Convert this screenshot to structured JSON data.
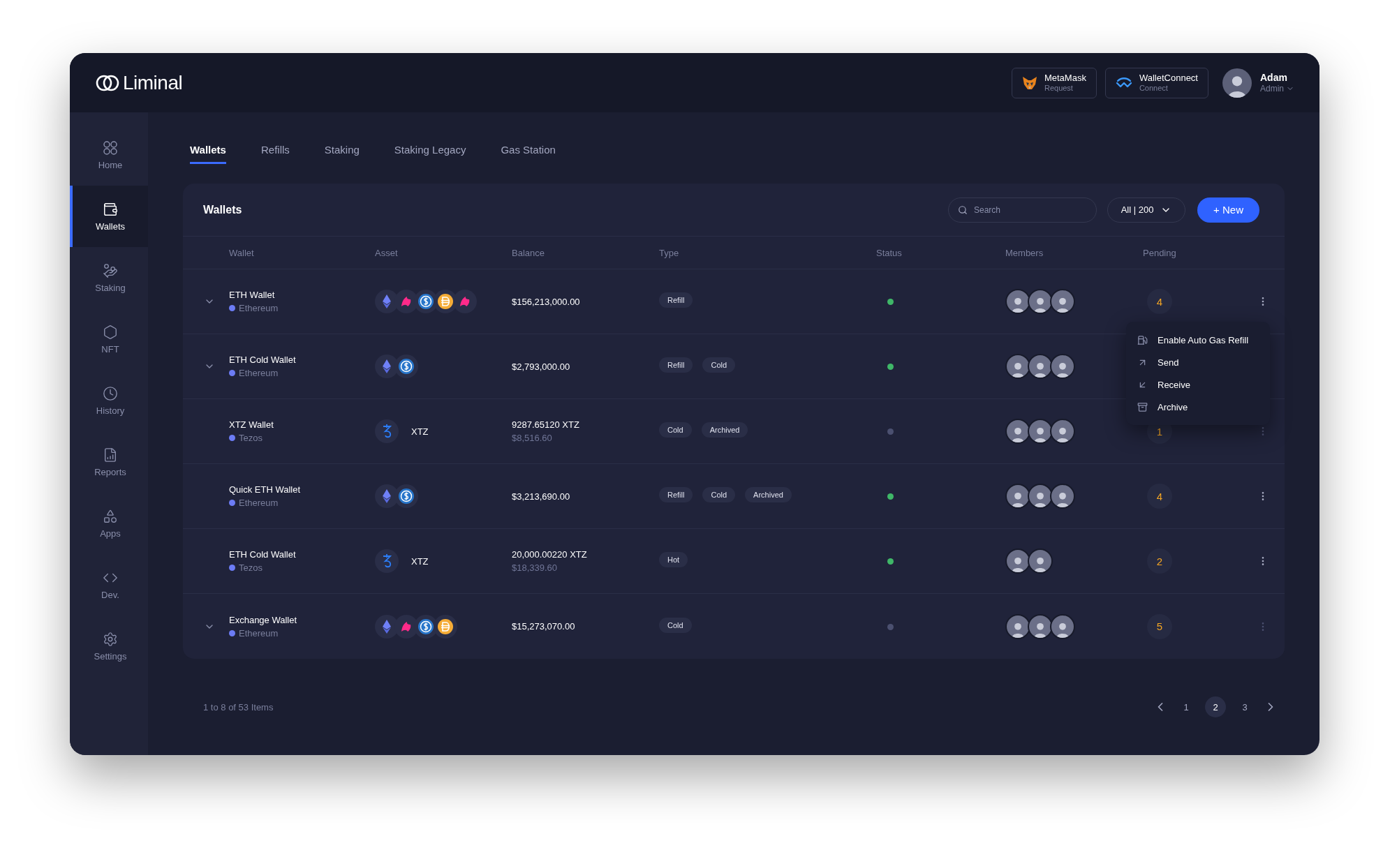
{
  "logo": "Liminal",
  "header": {
    "connections": [
      {
        "name": "MetaMask",
        "action": "Request",
        "kind": "metamask"
      },
      {
        "name": "WalletConnect",
        "action": "Connect",
        "kind": "walletconnect"
      }
    ],
    "user": {
      "name": "Adam",
      "role": "Admin"
    }
  },
  "sidebar": {
    "items": [
      {
        "label": "Home",
        "kind": "home",
        "selected": false
      },
      {
        "label": "Wallets",
        "kind": "wallet",
        "selected": true
      },
      {
        "label": "Staking",
        "kind": "staking",
        "selected": false
      },
      {
        "label": "NFT",
        "kind": "nft",
        "selected": false
      },
      {
        "label": "History",
        "kind": "history",
        "selected": false
      },
      {
        "label": "Reports",
        "kind": "reports",
        "selected": false
      },
      {
        "label": "Apps",
        "kind": "apps",
        "selected": false
      },
      {
        "label": "Dev.",
        "kind": "dev",
        "selected": false
      },
      {
        "label": "Settings",
        "kind": "settings",
        "selected": false
      }
    ]
  },
  "tabs": [
    {
      "label": "Wallets",
      "selected": true
    },
    {
      "label": "Refills",
      "selected": false
    },
    {
      "label": "Staking",
      "selected": false
    },
    {
      "label": "Staking Legacy",
      "selected": false
    },
    {
      "label": "Gas Station",
      "selected": false
    }
  ],
  "panel": {
    "title": "Wallets",
    "search": {
      "placeholder": "Search"
    },
    "filter": {
      "value": "All | 200"
    },
    "new_button": "+ New"
  },
  "table": {
    "columns": [
      "Wallet",
      "Asset",
      "Balance",
      "Type",
      "Status",
      "Members",
      "Pending"
    ],
    "rows": [
      {
        "expandable": true,
        "name": "ETH Wallet",
        "network": "Ethereum",
        "assets": [
          {
            "kind": "eth"
          },
          {
            "kind": "uni"
          },
          {
            "kind": "usdc"
          },
          {
            "kind": "dai"
          },
          {
            "kind": "uni"
          }
        ],
        "balance": "$156,213,000.00",
        "types": [
          "Refill"
        ],
        "active": true,
        "members": [
          {
            "kind": "photo"
          },
          {
            "kind": "photo"
          },
          {
            "kind": "photo"
          }
        ],
        "pending": "4",
        "more_button": true,
        "menu": {
          "items": [
            {
              "label": "Enable Auto Gas Refill",
              "kind": "gas"
            },
            {
              "label": "Send",
              "kind": "send"
            },
            {
              "label": "Receive",
              "kind": "receive"
            },
            {
              "label": "Archive",
              "kind": "archive"
            }
          ]
        }
      },
      {
        "expandable": true,
        "name": "ETH Cold Wallet",
        "network": "Ethereum",
        "assets": [
          {
            "kind": "eth"
          },
          {
            "kind": "usdc"
          }
        ],
        "balance": "$2,793,000.00",
        "types": [
          "Refill",
          "Cold"
        ],
        "active": true,
        "members": [
          {
            "kind": "photo"
          },
          {
            "kind": "photo"
          },
          {
            "kind": "photo"
          }
        ],
        "more_button": false
      },
      {
        "expandable": false,
        "name": "XTZ Wallet",
        "network": "Tezos",
        "assets": [
          {
            "kind": "xtz"
          }
        ],
        "asset_label": "XTZ",
        "balance": "9287.65120 XTZ",
        "balance_usd": "$8,516.60",
        "types": [
          "Cold",
          "Archived"
        ],
        "active": false,
        "members": [
          {
            "kind": "photo"
          },
          {
            "kind": "photo"
          },
          {
            "kind": "photo"
          }
        ],
        "pending": "1",
        "more_button": true
      },
      {
        "expandable": false,
        "name": "Quick ETH Wallet",
        "network": "Ethereum",
        "assets": [
          {
            "kind": "eth"
          },
          {
            "kind": "usdc"
          }
        ],
        "balance": "$3,213,690.00",
        "types": [
          "Refill",
          "Cold",
          "Archived"
        ],
        "active": true,
        "members": [
          {
            "kind": "photo"
          },
          {
            "kind": "photo"
          },
          {
            "kind": "photo"
          }
        ],
        "pending": "4",
        "more_button": true
      },
      {
        "expandable": false,
        "name": "ETH Cold Wallet",
        "network": "Tezos",
        "assets": [
          {
            "kind": "xtz"
          }
        ],
        "asset_label": "XTZ",
        "balance": "20,000.00220 XTZ",
        "balance_usd": "$18,339.60",
        "types": [
          "Hot"
        ],
        "active": true,
        "members": [
          {
            "kind": "photo"
          },
          {
            "kind": "photo"
          }
        ],
        "pending": "2",
        "more_button": true
      },
      {
        "expandable": true,
        "name": "Exchange Wallet",
        "network": "Ethereum",
        "assets": [
          {
            "kind": "eth"
          },
          {
            "kind": "uni"
          },
          {
            "kind": "usdc"
          },
          {
            "kind": "dai"
          }
        ],
        "balance": "$15,273,070.00",
        "types": [
          "Cold"
        ],
        "active": false,
        "members": [
          {
            "kind": "photo"
          },
          {
            "kind": "photo"
          },
          {
            "kind": "photo"
          }
        ],
        "pending": "5",
        "more_button": true
      }
    ]
  },
  "pagination": {
    "summary": "1 to 8 of 53 Items",
    "pages": [
      {
        "label": "1",
        "selected": false
      },
      {
        "label": "2",
        "selected": true
      },
      {
        "label": "3",
        "selected": false
      }
    ]
  }
}
